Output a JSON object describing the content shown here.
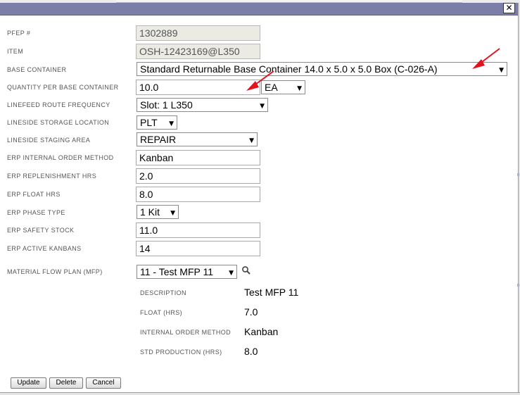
{
  "dialog": {
    "close_glyph": "✕"
  },
  "fields": {
    "pfep": {
      "label": "PFEP #",
      "value": "1302889"
    },
    "item": {
      "label": "ITEM",
      "value": "OSH-12423169@L350"
    },
    "base_container": {
      "label": "BASE CONTAINER",
      "value": "Standard Returnable Base Container 14.0 x 5.0 x 5.0 Box (C-026-A)"
    },
    "qty_per_base": {
      "label": "QUANTITY PER BASE CONTAINER",
      "value": "10.0",
      "unit": "EA"
    },
    "linefeed_route": {
      "label": "LINEFEED ROUTE FREQUENCY",
      "value": "Slot: 1 L350"
    },
    "storage_loc": {
      "label": "LINESIDE STORAGE LOCATION",
      "value": "PLT"
    },
    "staging_area": {
      "label": "LINESIDE STAGING AREA",
      "value": "REPAIR"
    },
    "order_method": {
      "label": "ERP INTERNAL ORDER METHOD",
      "value": "Kanban"
    },
    "replenish_hrs": {
      "label": "ERP REPLENISHMENT HRS",
      "value": "2.0"
    },
    "float_hrs": {
      "label": "ERP FLOAT HRS",
      "value": "8.0"
    },
    "phase_type": {
      "label": "ERP PHASE TYPE",
      "value": "1 Kit"
    },
    "safety_stock": {
      "label": "ERP SAFETY STOCK",
      "value": "11.0"
    },
    "active_kanbans": {
      "label": "ERP ACTIVE KANBANS",
      "value": "14"
    },
    "mfp": {
      "label": "MATERIAL FLOW PLAN (MFP)",
      "value": "11 - Test MFP 11"
    }
  },
  "mfp_details": {
    "description": {
      "label": "DESCRIPTION",
      "value": "Test MFP 11"
    },
    "float": {
      "label": "FLOAT (HRS)",
      "value": "7.0"
    },
    "order_method": {
      "label": "INTERNAL ORDER METHOD",
      "value": "Kanban"
    },
    "std_prod": {
      "label": "STD PRODUCTION (HRS)",
      "value": "8.0"
    }
  },
  "buttons": {
    "update": "Update",
    "delete": "Delete",
    "cancel": "Cancel"
  },
  "icons": {
    "dropdown": "▼",
    "search": "search-icon"
  },
  "colors": {
    "titlebar": "#7b7fa8",
    "annotation_arrow": "#e0141e"
  }
}
